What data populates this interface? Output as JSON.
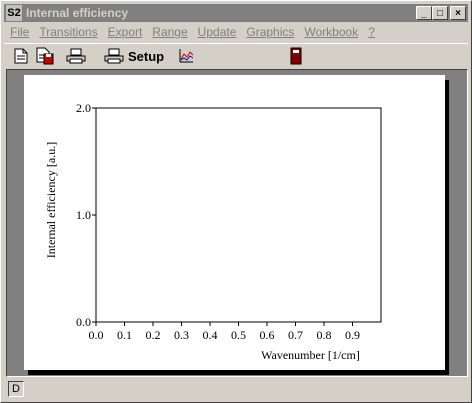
{
  "window": {
    "title": "Internal efficiency",
    "icon_label": "S2",
    "controls": {
      "minimize": "_",
      "maximize": "□",
      "close": "×"
    }
  },
  "menu": {
    "items": [
      "File",
      "Transitions",
      "Export",
      "Range",
      "Update",
      "Graphics",
      "Workbook",
      "?"
    ]
  },
  "toolbar": {
    "setup_label": "Setup",
    "icons": [
      "page-icon",
      "page-save-icon",
      "print-icon",
      "print-setup-icon",
      "chart-icon",
      "device-icon"
    ]
  },
  "status": {
    "indicator": "D"
  },
  "chart_data": {
    "type": "line",
    "series": [],
    "xlabel": "Wavenumber [1/cm]",
    "ylabel": "Internal efficiency [a.u.]",
    "xlim": [
      0.0,
      1.0
    ],
    "ylim": [
      0.0,
      2.0
    ],
    "xticks": [
      "0.0",
      "0.1",
      "0.2",
      "0.3",
      "0.4",
      "0.5",
      "0.6",
      "0.7",
      "0.8",
      "0.9"
    ],
    "yticks": [
      "0.0",
      "1.0",
      "2.0"
    ],
    "grid": false
  }
}
